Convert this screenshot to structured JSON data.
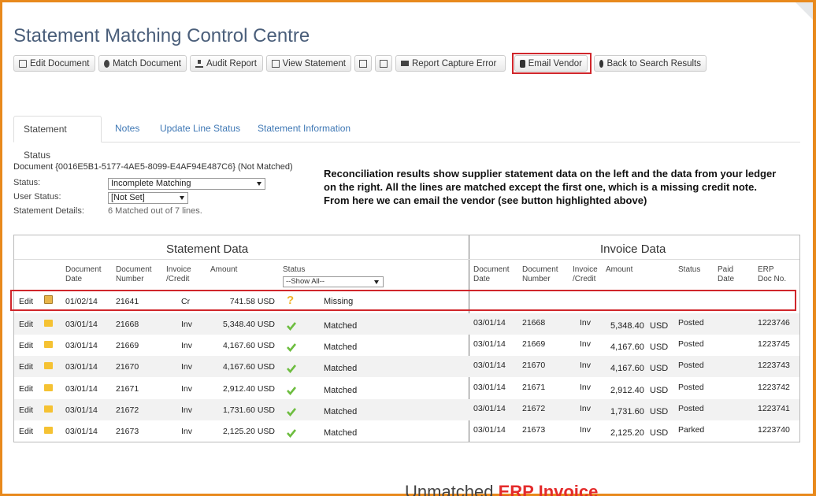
{
  "page_title": "Statement Matching Control Centre",
  "toolbar": {
    "edit_document": "Edit Document",
    "match_document": "Match Document",
    "audit_report": "Audit Report",
    "view_statement": "View Statement",
    "report_capture_error": "Report Capture Error",
    "email_vendor": "Email Vendor",
    "back_to_search": "Back to Search Results"
  },
  "tabs": [
    "Statement Status",
    "Notes",
    "Update Line Status",
    "Statement Information"
  ],
  "document": {
    "heading": "Document {0016E5B1-5177-4AE5-8099-E4AF94E487C6}  (Not Matched)",
    "status_label": "Status:",
    "status_value": "Incomplete Matching",
    "user_status_label": "User Status:",
    "user_status_value": "[Not Set]",
    "details_label": "Statement Details:",
    "details_value": "6 Matched out of 7 lines."
  },
  "annotation": "Reconciliation results show supplier statement data on the left and the data from your ledger on the right. All the lines are matched except the first one, which is a missing credit note. From here we can email the vendor (see button highlighted above)",
  "statement": {
    "title": "Statement Data",
    "headers": {
      "doc_date": [
        "Document",
        "Date"
      ],
      "doc_number": [
        "Document",
        "Number"
      ],
      "inv_credit": [
        "Invoice",
        "/Credit"
      ],
      "amount": "Amount",
      "status": "Status",
      "filter": "--Show All--"
    }
  },
  "invoice": {
    "title": "Invoice Data",
    "headers": {
      "doc_date": [
        "Document",
        "Date"
      ],
      "doc_number": [
        "Document",
        "Number"
      ],
      "inv_credit": [
        "Invoice",
        "/Credit"
      ],
      "amount": "Amount",
      "status": "Status",
      "paid_date": [
        "Paid",
        "Date"
      ],
      "erp": [
        "ERP",
        "Doc No."
      ]
    }
  },
  "rows": [
    {
      "edit": "Edit",
      "date": "01/02/14",
      "number": "21641",
      "type": "Cr",
      "amount": "741.58 USD",
      "status": "Missing",
      "status_icon": "question-icon",
      "inv_date": "",
      "inv_number": "",
      "inv_type": "",
      "inv_amount": "",
      "inv_currency": "",
      "inv_status": "",
      "erp": ""
    },
    {
      "edit": "Edit",
      "date": "03/01/14",
      "number": "21668",
      "type": "Inv",
      "amount": "5,348.40 USD",
      "status": "Matched",
      "status_icon": "check-icon",
      "inv_date": "03/01/14",
      "inv_number": "21668",
      "inv_type": "Inv",
      "inv_amount": "5,348.40",
      "inv_currency": "USD",
      "inv_status": "Posted",
      "erp": "1223746"
    },
    {
      "edit": "Edit",
      "date": "03/01/14",
      "number": "21669",
      "type": "Inv",
      "amount": "4,167.60 USD",
      "status": "Matched",
      "status_icon": "check-icon",
      "inv_date": "03/01/14",
      "inv_number": "21669",
      "inv_type": "Inv",
      "inv_amount": "4,167.60",
      "inv_currency": "USD",
      "inv_status": "Posted",
      "erp": "1223745"
    },
    {
      "edit": "Edit",
      "date": "03/01/14",
      "number": "21670",
      "type": "Inv",
      "amount": "4,167.60 USD",
      "status": "Matched",
      "status_icon": "check-icon",
      "inv_date": "03/01/14",
      "inv_number": "21670",
      "inv_type": "Inv",
      "inv_amount": "4,167.60",
      "inv_currency": "USD",
      "inv_status": "Posted",
      "erp": "1223743"
    },
    {
      "edit": "Edit",
      "date": "03/01/14",
      "number": "21671",
      "type": "Inv",
      "amount": "2,912.40 USD",
      "status": "Matched",
      "status_icon": "check-icon",
      "inv_date": "03/01/14",
      "inv_number": "21671",
      "inv_type": "Inv",
      "inv_amount": "2,912.40",
      "inv_currency": "USD",
      "inv_status": "Posted",
      "erp": "1223742"
    },
    {
      "edit": "Edit",
      "date": "03/01/14",
      "number": "21672",
      "type": "Inv",
      "amount": "1,731.60 USD",
      "status": "Matched",
      "status_icon": "check-icon",
      "inv_date": "03/01/14",
      "inv_number": "21672",
      "inv_type": "Inv",
      "inv_amount": "1,731.60",
      "inv_currency": "USD",
      "inv_status": "Posted",
      "erp": "1223741"
    },
    {
      "edit": "Edit",
      "date": "03/01/14",
      "number": "21673",
      "type": "Inv",
      "amount": "2,125.20 USD",
      "status": "Matched",
      "status_icon": "check-icon",
      "inv_date": "03/01/14",
      "inv_number": "21673",
      "inv_type": "Inv",
      "inv_amount": "2,125.20",
      "inv_currency": "USD",
      "inv_status": "Parked",
      "erp": "1223740"
    }
  ],
  "footer": {
    "part1": "Unmatched ",
    "part2": "ERP Invoice"
  },
  "colors": {
    "frame": "#e8891c",
    "highlight": "#d0262b",
    "link": "#3f78b5",
    "check": "#6dbd3f",
    "question": "#f0b32a"
  }
}
